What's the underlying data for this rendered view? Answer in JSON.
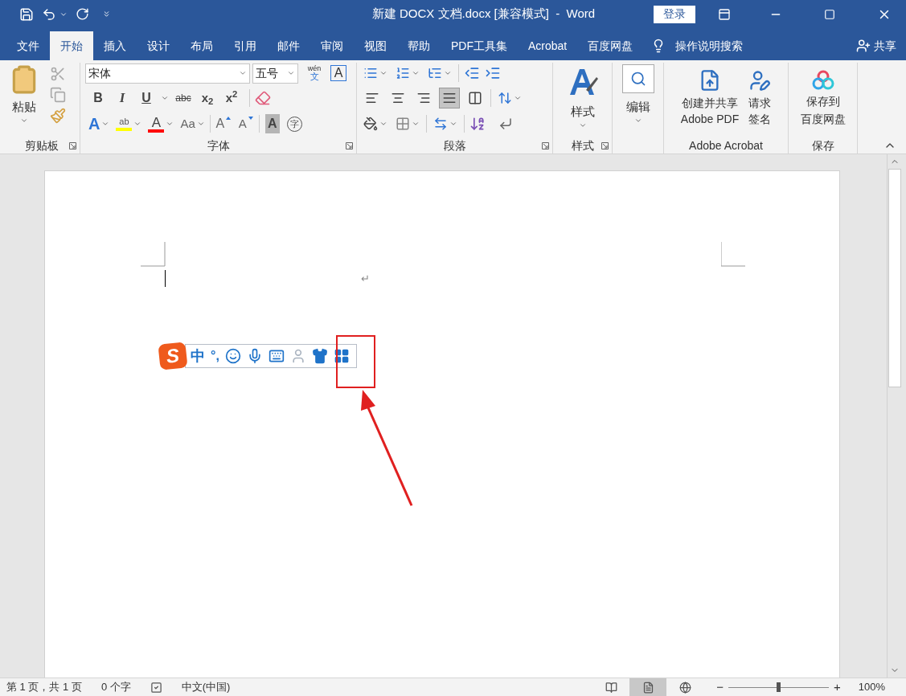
{
  "title_bar": {
    "title": "新建 DOCX 文档.docx [兼容模式]  -  Word",
    "login": "登录"
  },
  "tabs": [
    {
      "label": "文件",
      "selected": false
    },
    {
      "label": "开始",
      "selected": true
    },
    {
      "label": "插入",
      "selected": false
    },
    {
      "label": "设计",
      "selected": false
    },
    {
      "label": "布局",
      "selected": false
    },
    {
      "label": "引用",
      "selected": false
    },
    {
      "label": "邮件",
      "selected": false
    },
    {
      "label": "审阅",
      "selected": false
    },
    {
      "label": "视图",
      "selected": false
    },
    {
      "label": "帮助",
      "selected": false
    },
    {
      "label": "PDF工具集",
      "selected": false
    },
    {
      "label": "Acrobat",
      "selected": false
    },
    {
      "label": "百度网盘",
      "selected": false
    }
  ],
  "tell_me": "操作说明搜索",
  "share": "共享",
  "ribbon": {
    "clipboard": {
      "paste": "粘贴",
      "label": "剪贴板"
    },
    "font": {
      "font_name": "宋体",
      "font_size": "五号",
      "phonetic_top": "wén",
      "phonetic_bottom": "文",
      "char_border": "A",
      "label": "字体",
      "format_buttons": [
        {
          "kind": "bold",
          "label": "B"
        },
        {
          "kind": "italic",
          "label": "I"
        },
        {
          "kind": "underline",
          "label": "U"
        },
        {
          "kind": "strike",
          "label": "abc"
        },
        {
          "kind": "sub",
          "label": "x$_{2}$"
        },
        {
          "kind": "sup",
          "label": "x$^{2}$"
        }
      ],
      "effects": [
        {
          "kind": "text_effects",
          "label": "A"
        },
        {
          "kind": "highlight",
          "label": "ab"
        },
        {
          "kind": "font_color",
          "label": "A"
        },
        {
          "kind": "change_case",
          "label": "Aa"
        },
        {
          "kind": "grow",
          "label": "A"
        },
        {
          "kind": "shrink",
          "label": "A"
        },
        {
          "kind": "char_shading",
          "label": "A"
        },
        {
          "kind": "enclose",
          "label": "字"
        }
      ]
    },
    "paragraph": {
      "label": "段落",
      "alignments": [
        {
          "kind": "left",
          "selected": false
        },
        {
          "kind": "center",
          "selected": false
        },
        {
          "kind": "right",
          "selected": false
        },
        {
          "kind": "justify",
          "selected": true
        },
        {
          "kind": "distributed",
          "selected": false
        }
      ]
    },
    "styles": {
      "button": "样式",
      "label": "样式"
    },
    "editing": {
      "button": "编辑"
    },
    "acrobat": {
      "buttons": [
        [
          "创建并共享",
          "Adobe PDF"
        ],
        [
          "请求",
          "签名"
        ]
      ],
      "label": "Adobe Acrobat"
    },
    "save": {
      "button": [
        "保存到",
        "百度网盘"
      ],
      "label": "保存"
    }
  },
  "document": {
    "return_mark": "↵",
    "ime_toolbar": {
      "logo": "S",
      "language": "中",
      "punctuation": "°,"
    }
  },
  "status_bar": {
    "page": "第 1 页，共 1 页",
    "words": "0 个字",
    "language": "中文(中国)",
    "views": [
      {
        "kind": "read",
        "selected": false
      },
      {
        "kind": "print",
        "selected": true
      },
      {
        "kind": "web",
        "selected": false
      }
    ],
    "zoom_out": "−",
    "zoom": {
      "level": 0.5
    },
    "zoom_in": "+",
    "zoom_percent": "100%"
  }
}
